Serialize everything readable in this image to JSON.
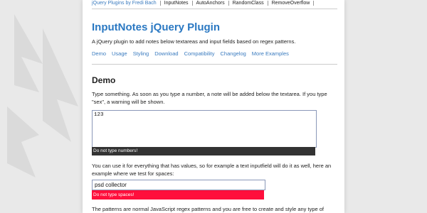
{
  "top_nav": {
    "items": [
      "jQuery Plugins by Fredi Bach",
      "InputNotes",
      "AutoAnchors",
      "RandomClass",
      "RemoveOverflow"
    ]
  },
  "header": {
    "title": "InputNotes jQuery Plugin",
    "description": "A jQuery plugin to add notes below textareas and input fields based on regex patterns."
  },
  "menu": {
    "items": [
      "Demo",
      "Usage",
      "Styling",
      "Download",
      "Compatibility",
      "Changelog",
      "More Examples"
    ]
  },
  "demo": {
    "heading": "Demo",
    "intro": "Type something. As soon as you type a number, a note will be added below the textarea. If you type \"sex\", a warning will be shown.",
    "textarea_value": "123",
    "textarea_note": "Do not type numbers!",
    "input_intro": "You can use it for everything that has values, so for example a text inputfield will do it as well, here an example where we test for spaces:",
    "input_value": "psd collector",
    "input_note": "Do not type spaces!",
    "patterns_text": "The patterns are normal JavaScript regex patterns and you are free to create and style any type of"
  },
  "colors": {
    "link": "#3a7bbf",
    "title": "#2a78c2",
    "note_dark": "#333333",
    "note_warning": "#ff0f3c",
    "background": "#e9e9e9"
  }
}
